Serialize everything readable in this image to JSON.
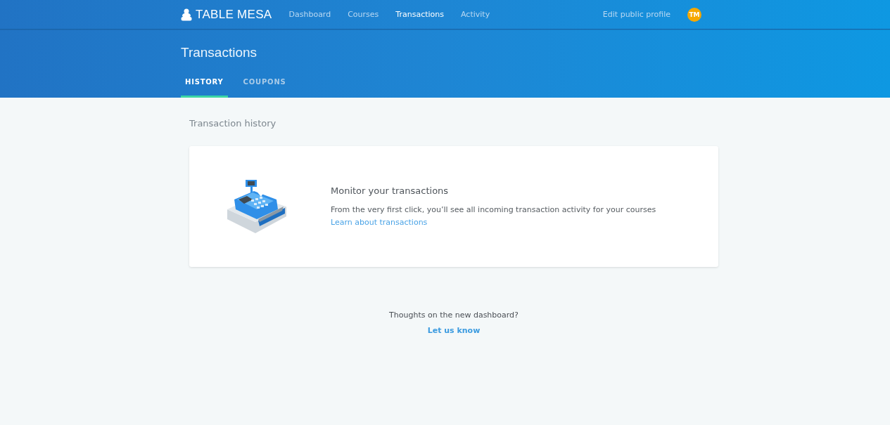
{
  "brand": "TABLE MESA",
  "nav": [
    {
      "label": "Dashboard",
      "selected": false
    },
    {
      "label": "Courses",
      "selected": false
    },
    {
      "label": "Transactions",
      "selected": true
    },
    {
      "label": "Activity",
      "selected": false
    }
  ],
  "profile_link": "Edit public profile",
  "avatar": "TM",
  "page_title": "Transactions",
  "tabs": [
    {
      "label": "HISTORY",
      "selected": true
    },
    {
      "label": "COUPONS",
      "selected": false
    }
  ],
  "section_title": "Transaction history",
  "empty_card": {
    "title": "Monitor your transactions",
    "text": "From the very first click, you’ll see all incoming transaction activity for your courses",
    "link": "Learn about transactions"
  },
  "feedback": {
    "question": "Thoughts on the new dashboard?",
    "link": "Let us know"
  }
}
